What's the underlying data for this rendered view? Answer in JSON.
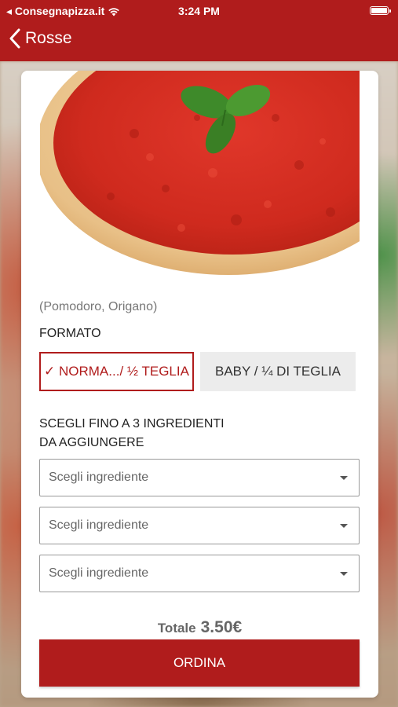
{
  "status_bar": {
    "carrier": "◂ Consegnapizza.it",
    "time": "3:24 PM"
  },
  "nav": {
    "back_label": "Rosse"
  },
  "product": {
    "ingredients": "(Pomodoro, Origano)",
    "format_title": "FORMATO",
    "sizes": [
      {
        "label": "✓ NORMA.../ ½ TEGLIA",
        "selected": true
      },
      {
        "label": "BABY / ¼ DI TEGLIA",
        "selected": false
      }
    ],
    "ingredients_title_line1": "SCEGLI FINO A 3 INGREDIENTI",
    "ingredients_title_line2": "DA AGGIUNGERE",
    "selects": [
      {
        "placeholder": "Scegli ingrediente"
      },
      {
        "placeholder": "Scegli ingrediente"
      },
      {
        "placeholder": "Scegli ingrediente"
      }
    ],
    "total_label": "Totale",
    "total_value": "3.50€",
    "order_label": "ORDINA"
  },
  "colors": {
    "brand": "#b01c1c"
  }
}
